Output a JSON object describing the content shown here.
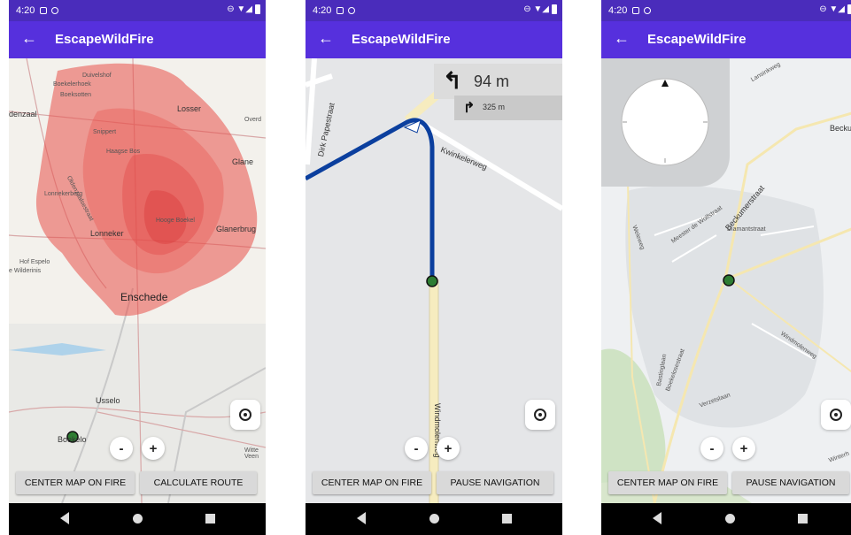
{
  "colors": {
    "status_bar": "#4a2cbb",
    "app_bar": "#5630dd",
    "fire": "#e8504a",
    "route": "#0b3f9e"
  },
  "status": {
    "time": "4:20",
    "right_glyphs": "⊖ ▼◢"
  },
  "app": {
    "title": "EscapeWildFire",
    "back_icon": "←"
  },
  "screens": [
    {
      "buttons": {
        "left": "CENTER MAP ON FIRE",
        "right": "CALCULATE ROUTE"
      },
      "zoom": {
        "minus": "-",
        "plus": "+"
      },
      "map_labels": [
        "Duivelshof",
        "Boekelerhoek",
        "Boeksotten",
        "denzaal",
        "Losser",
        "Overd",
        "Snippert",
        "Haagse Bos",
        "Glane",
        "Lonnekerberg",
        "Oldenzaalsestraat",
        "Lonneker",
        "Hooge Boekel",
        "Glanerbrug",
        "Hof Espelo",
        "e Wilderinis",
        "Enschede",
        "Usselo",
        "Boekelo",
        "Witte Veen"
      ]
    },
    {
      "buttons": {
        "left": "CENTER MAP ON FIRE",
        "right": "PAUSE NAVIGATION"
      },
      "zoom": {
        "minus": "-",
        "plus": "+"
      },
      "navigation": {
        "main_arrow": "↰",
        "main_distance": "94 m",
        "next_arrow": "↱",
        "next_distance": "325 m"
      },
      "map_labels": [
        "Dirk Papestraat",
        "Kwinkelerweg",
        "Windmolenweg"
      ]
    },
    {
      "buttons": {
        "left": "CENTER MAP ON FIRE",
        "right": "PAUSE NAVIGATION"
      },
      "zoom": {
        "minus": "-",
        "plus": "+"
      },
      "map_labels": [
        "Lansinkweg",
        "Beckum",
        "Beckumerstraat",
        "Meester de Wolfstraat",
        "Diamantstraat",
        "Weleweg",
        "Bastinglaan",
        "Boekelosestraat",
        "Windmolenweg",
        "Verzetslaan",
        "Winterh"
      ]
    }
  ]
}
